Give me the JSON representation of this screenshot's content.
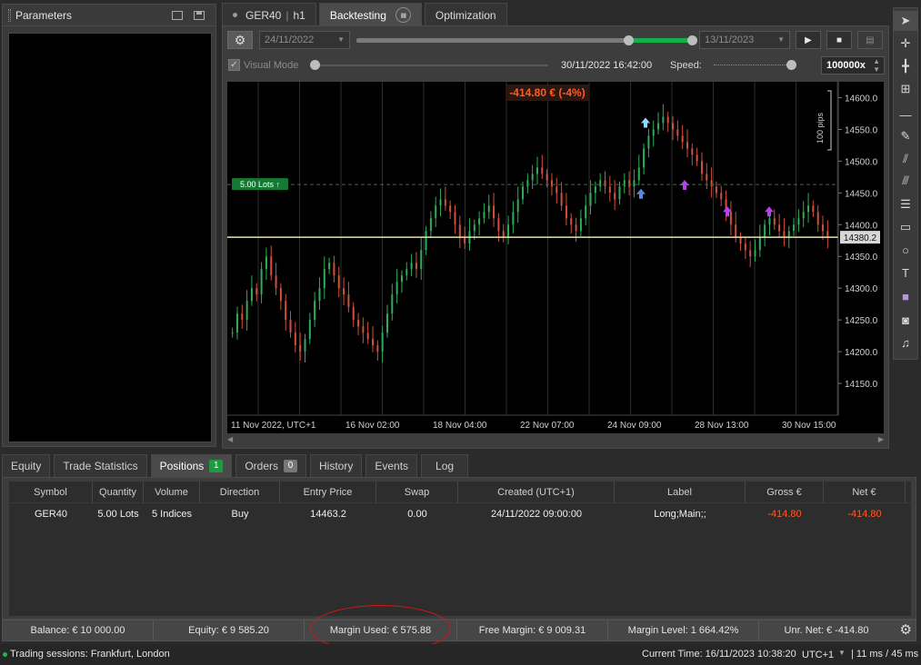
{
  "parameters": {
    "title": "Parameters"
  },
  "top_tabs": {
    "symbol": "GER40",
    "timeframe": "h1",
    "backtesting": "Backtesting",
    "optimization": "Optimization"
  },
  "controls": {
    "start_date": "24/11/2022",
    "end_date": "13/11/2023",
    "progress_fraction": 0.93,
    "visual_mode": "Visual Mode",
    "visual_mode_checked": true,
    "current_time": "30/11/2022 16:42:00",
    "speed_label": "Speed:",
    "speed_value": "100000x"
  },
  "chart": {
    "pnl_label": "-414.80 € (-4%)",
    "lots_label": "5.00 Lots ↑",
    "scale_label": "100 pips",
    "price_tag": "14380.2",
    "price_ticks": [
      "14600.0",
      "14550.0",
      "14500.0",
      "14450.0",
      "14400.0",
      "14350.0",
      "14300.0",
      "14250.0",
      "14200.0",
      "14150.0"
    ],
    "time_ticks": [
      "11 Nov 2022, UTC+1",
      "16 Nov 02:00",
      "18 Nov 04:00",
      "22 Nov 07:00",
      "24 Nov 09:00",
      "28 Nov 13:00",
      "30 Nov 15:00"
    ]
  },
  "chart_data": {
    "type": "candlestick",
    "title": "",
    "symbol": "GER40",
    "timeframe": "h1",
    "x_tick_labels": [
      "11 Nov 2022, UTC+1",
      "16 Nov 02:00",
      "18 Nov 04:00",
      "22 Nov 07:00",
      "24 Nov 09:00",
      "28 Nov 13:00",
      "30 Nov 15:00"
    ],
    "y_tick_labels": [
      14600,
      14550,
      14500,
      14450,
      14400,
      14350,
      14300,
      14250,
      14200,
      14150
    ],
    "ylim": [
      14100,
      14625
    ],
    "entry_price": 14463.2,
    "current_price": 14380.2,
    "grid": true,
    "series": [
      {
        "segment": "11 Nov - 16 Nov",
        "approx_close": [
          14230,
          14260,
          14250,
          14280,
          14300,
          14290,
          14330,
          14350,
          14320,
          14300,
          14280,
          14250,
          14230,
          14210,
          14200,
          14220,
          14250,
          14280,
          14300,
          14330,
          14340,
          14320,
          14300,
          14290
        ]
      },
      {
        "segment": "16 Nov - 18 Nov",
        "approx_close": [
          14270,
          14250,
          14240,
          14230,
          14220,
          14210,
          14200,
          14230,
          14260,
          14290,
          14310,
          14320,
          14330,
          14340,
          14330,
          14360,
          14390,
          14410,
          14430,
          14440
        ]
      },
      {
        "segment": "18 Nov - 22 Nov",
        "approx_close": [
          14430,
          14420,
          14400,
          14380,
          14370,
          14390,
          14400,
          14410,
          14420,
          14430,
          14410,
          14390,
          14380,
          14400,
          14420,
          14440,
          14460,
          14470,
          14480,
          14490
        ]
      },
      {
        "segment": "22 Nov - 24 Nov",
        "approx_close": [
          14480,
          14470,
          14460,
          14450,
          14430,
          14410,
          14400,
          14390,
          14410,
          14430,
          14450,
          14460,
          14470,
          14460,
          14450,
          14440,
          14460,
          14470,
          14460,
          14470
        ]
      },
      {
        "segment": "24 Nov - 28 Nov",
        "approx_close": [
          14490,
          14520,
          14540,
          14550,
          14560,
          14570,
          14560,
          14550,
          14540,
          14530,
          14520,
          14510,
          14500,
          14480,
          14470,
          14460,
          14450,
          14440,
          14420,
          14400
        ]
      },
      {
        "segment": "28 Nov - 30 Nov",
        "approx_close": [
          14380,
          14370,
          14360,
          14350,
          14360,
          14380,
          14400,
          14410,
          14400,
          14390,
          14380,
          14390,
          14400,
          14410,
          14420,
          14430,
          14420,
          14400,
          14390,
          14380
        ]
      }
    ]
  },
  "bottom_tabs": [
    {
      "label": "Equity"
    },
    {
      "label": "Trade Statistics"
    },
    {
      "label": "Positions",
      "badge": "1"
    },
    {
      "label": "Orders",
      "badge": "0"
    },
    {
      "label": "History"
    },
    {
      "label": "Events"
    },
    {
      "label": "Log"
    }
  ],
  "positions": {
    "columns": [
      "Symbol",
      "Quantity",
      "Volume",
      "Direction",
      "Entry Price",
      "Swap",
      "Created (UTC+1)",
      "Label",
      "Gross €",
      "Net €"
    ],
    "rows": [
      [
        "GER40",
        "5.00 Lots",
        "5 Indices",
        "Buy",
        "14463.2",
        "0.00",
        "24/11/2022 09:00:00",
        "Long;Main;;",
        "-414.80",
        "-414.80"
      ]
    ]
  },
  "status": {
    "balance": "Balance: € 10 000.00",
    "equity": "Equity: € 9 585.20",
    "margin_used": "Margin Used: € 575.88",
    "free_margin": "Free Margin: € 9 009.31",
    "margin_level": "Margin Level: 1 664.42%",
    "unr_net": "Unr. Net: € -414.80"
  },
  "bottom_bar": {
    "sessions": "Trading sessions: Frankfurt, London",
    "current_time": "Current Time:  16/11/2023 10:38:20",
    "timezone": "UTC+1",
    "latency": "| 11 ms / 45 ms"
  },
  "colors": {
    "bull": "#2dae5a",
    "bear": "#d2503c",
    "price_line": "#e8e6a0",
    "accent_green": "#16b04a",
    "negative": "#ff5a24"
  }
}
